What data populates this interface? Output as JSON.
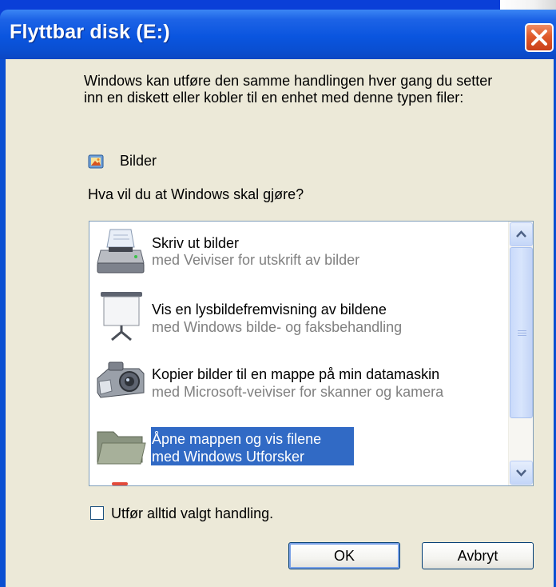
{
  "window": {
    "title": "Flyttbar disk (E:)"
  },
  "dialog": {
    "intro_text": "Windows kan utføre den samme handlingen hver gang du setter inn en diskett eller kobler til en enhet med denne typen filer:",
    "content_type_icon": "pictures-icon",
    "content_type_label": "Bilder",
    "question": "Hva vil du at Windows skal gjøre?"
  },
  "actions": [
    {
      "icon": "printer-icon",
      "title": "Skriv ut bilder",
      "subtitle": "med Veiviser for utskrift av bilder",
      "selected": false
    },
    {
      "icon": "projector-screen-icon",
      "title": "Vis en lysbildefremvisning av bildene",
      "subtitle": "med Windows bilde- og faksbehandling",
      "selected": false
    },
    {
      "icon": "camera-icon",
      "title": "Kopier bilder til en mappe på min datamaskin",
      "subtitle": "med Microsoft-veiviser for skanner og kamera",
      "selected": false
    },
    {
      "icon": "folder-icon",
      "title": "Åpne mappen og vis filene",
      "subtitle": "med Windows Utforsker",
      "selected": true
    }
  ],
  "checkbox": {
    "label": "Utfør alltid valgt handling.",
    "checked": false
  },
  "buttons": {
    "ok": "OK",
    "cancel": "Avbryt"
  },
  "colors": {
    "titlebar": "#0a55df",
    "selection": "#316ac5",
    "close_button": "#e05a2a"
  }
}
